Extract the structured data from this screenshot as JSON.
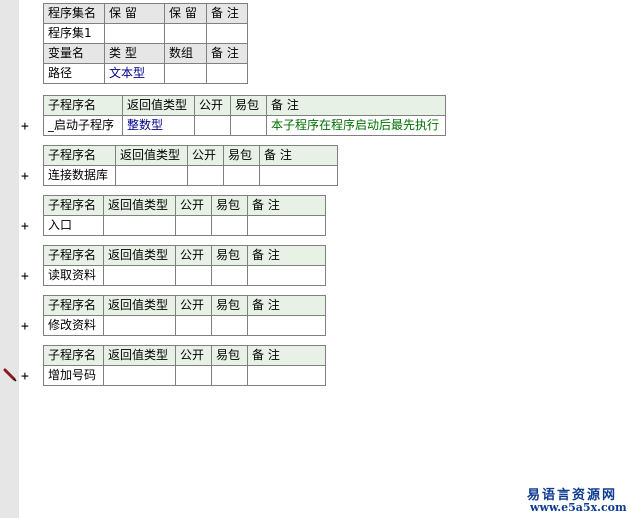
{
  "assembly": {
    "headers": [
      "程序集名",
      "保 留",
      "保 留",
      "备 注"
    ],
    "row": [
      "程序集1",
      "",
      "",
      ""
    ]
  },
  "variables": {
    "headers": [
      "变量名",
      "类 型",
      "数组",
      "备 注"
    ],
    "row": [
      "路径",
      "文本型",
      "",
      ""
    ]
  },
  "subprogram_headers": [
    "子程序名",
    "返回值类型",
    "公开",
    "易包",
    "备 注"
  ],
  "subprograms": [
    {
      "name": "_启动子程序",
      "return_type": "整数型",
      "public": "",
      "easy_pkg": "",
      "note": "本子程序在程序启动后最先执行",
      "expand": "+"
    },
    {
      "name": "连接数据库",
      "return_type": "",
      "public": "",
      "easy_pkg": "",
      "note": "",
      "expand": "+"
    },
    {
      "name": "入口",
      "return_type": "",
      "public": "",
      "easy_pkg": "",
      "note": "",
      "expand": "+"
    },
    {
      "name": "读取资料",
      "return_type": "",
      "public": "",
      "easy_pkg": "",
      "note": "",
      "expand": "+"
    },
    {
      "name": "修改资料",
      "return_type": "",
      "public": "",
      "easy_pkg": "",
      "note": "",
      "expand": "+"
    },
    {
      "name": "增加号码",
      "return_type": "",
      "public": "",
      "easy_pkg": "",
      "note": "",
      "expand": "+"
    }
  ],
  "icons": {
    "cursor_marker": "pencil-icon"
  },
  "colors": {
    "header_bg": "#e8f1e6",
    "type_text": "#00008b",
    "note_text": "#007000",
    "watermark": "#0e3b8f"
  },
  "watermark": {
    "title": "易语言资源网",
    "url": "www.e5a5x.com"
  }
}
